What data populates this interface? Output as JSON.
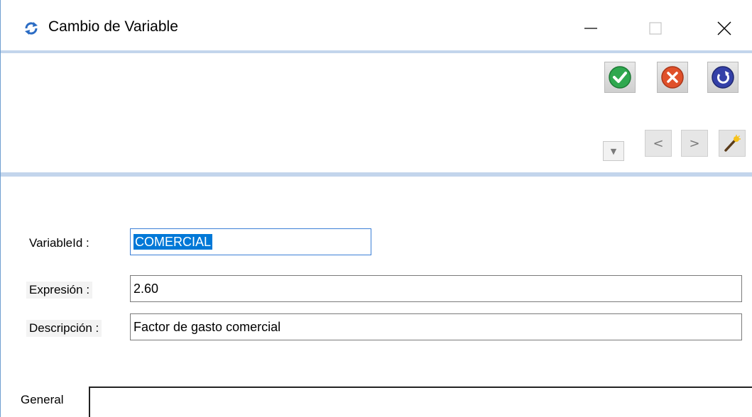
{
  "window": {
    "title": "Cambio de Variable",
    "app_icon": "refresh-arrows-icon",
    "controls": {
      "minimize": "minimize-icon",
      "maximize": "maximize-icon",
      "close": "close-icon"
    }
  },
  "toolbar": {
    "accept_icon": "check-circle-icon",
    "cancel_icon": "x-circle-icon",
    "undo_icon": "undo-circle-icon",
    "dropdown_glyph": "▼",
    "prev_glyph": "<",
    "next_glyph": ">",
    "wizard_icon": "magic-wand-icon",
    "colors": {
      "accept": "#2fa84f",
      "cancel": "#e0502a",
      "undo": "#3440a8"
    }
  },
  "form": {
    "variable_id": {
      "label": "VariableId :",
      "value": "COMERCIAL"
    },
    "expresion": {
      "label": "Expresión :",
      "value": "2.60"
    },
    "descripcion": {
      "label": "Descripción :",
      "value": "Factor de gasto comercial"
    }
  },
  "tabs": {
    "general": "General"
  },
  "colors": {
    "separator": "#c3d5ec",
    "selection": "#0078d7"
  }
}
